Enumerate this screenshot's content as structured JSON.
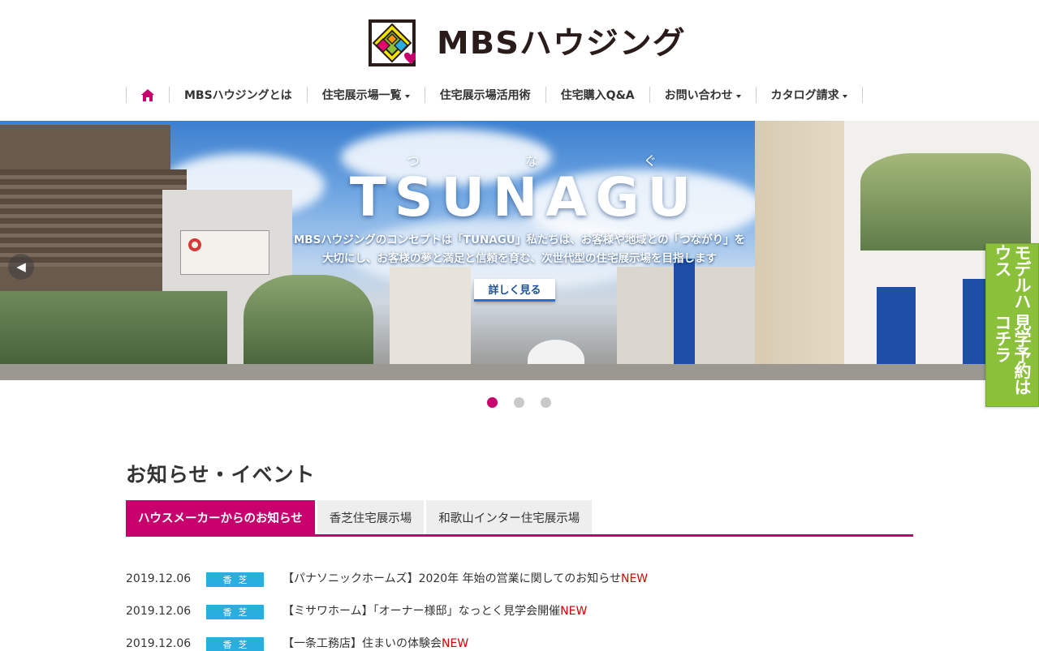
{
  "header": {
    "logo_text": "MBSハウジング"
  },
  "nav": {
    "items": [
      {
        "label": "MBSハウジングとは",
        "dropdown": false
      },
      {
        "label": "住宅展示場一覧",
        "dropdown": true
      },
      {
        "label": "住宅展示場活用術",
        "dropdown": false
      },
      {
        "label": "住宅購入Q&A",
        "dropdown": false
      },
      {
        "label": "お問い合わせ",
        "dropdown": true
      },
      {
        "label": "カタログ請求",
        "dropdown": true
      }
    ],
    "home_icon": "home-icon"
  },
  "hero": {
    "ruby": [
      "つ",
      "な",
      "ぐ"
    ],
    "title": "TSUNAGU",
    "desc_line1": "MBSハウジングのコンセプトは「TUNAGU」私たちは、お客様や地域との「つながり」を",
    "desc_line2": "大切にし、お客様の夢と満足と信頼を育む、次世代型の住宅展示場を目指します",
    "button_label": "詳しく見る",
    "prev_icon": "chevron-left-icon",
    "next_icon": "chevron-right-icon",
    "slide_count": 3,
    "active_slide": 1
  },
  "side_tab": {
    "line1": "モデルハウス",
    "line2": "見学予約はコチラ"
  },
  "news": {
    "title": "お知らせ・イベント",
    "tabs": [
      {
        "label": "ハウスメーカーからのお知らせ",
        "active": true
      },
      {
        "label": "香芝住宅展示場",
        "active": false
      },
      {
        "label": "和歌山インター住宅展示場",
        "active": false
      }
    ],
    "items": [
      {
        "date": "2019.12.06",
        "badge": "香芝",
        "text": "【パナソニックホームズ】2020年 年始の営業に関してのお知らせ",
        "new": "NEW"
      },
      {
        "date": "2019.12.06",
        "badge": "香芝",
        "text": "【ミサワホーム】「オーナー様邸」なっとく見学会開催",
        "new": "NEW"
      },
      {
        "date": "2019.12.06",
        "badge": "香芝",
        "text": "【一条工務店】住まいの体験会",
        "new": "NEW"
      }
    ]
  },
  "colors": {
    "accent": "#c8006e",
    "badge": "#2aaee0",
    "new": "#d40000",
    "side_tab": "#8bc13a"
  }
}
